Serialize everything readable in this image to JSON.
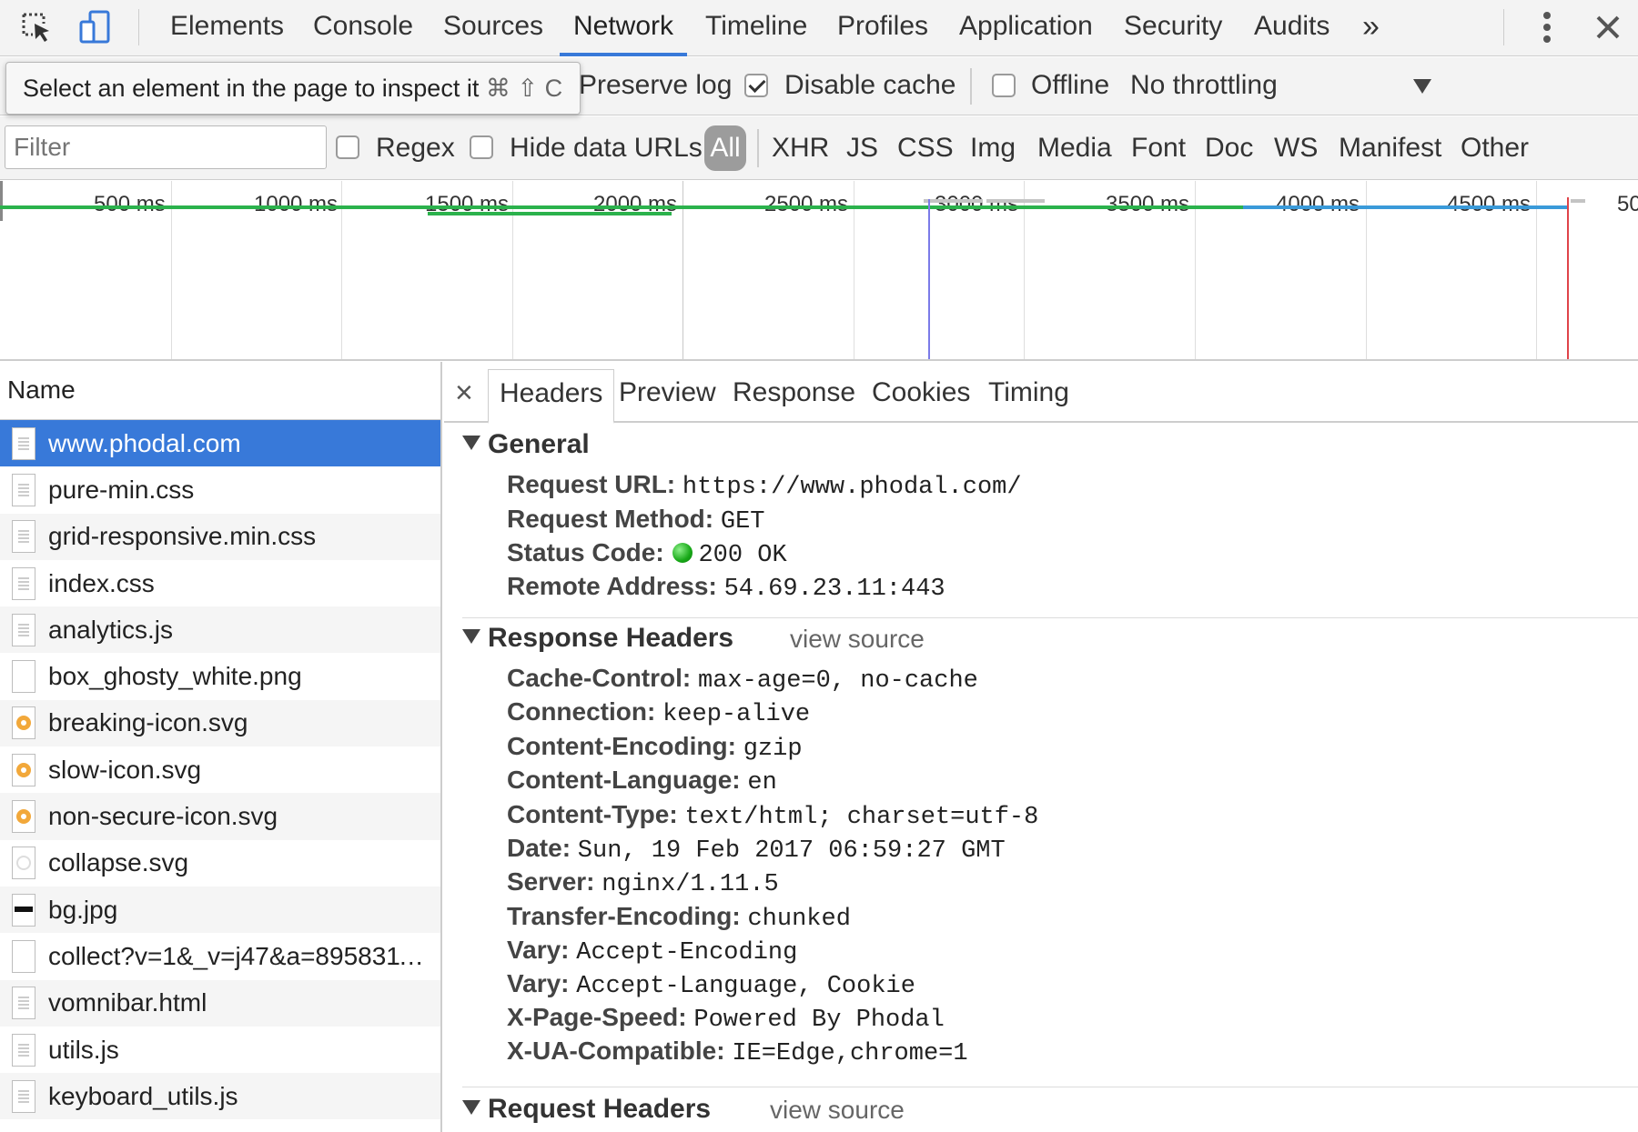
{
  "top_tabs": [
    {
      "label": "Elements"
    },
    {
      "label": "Console"
    },
    {
      "label": "Sources"
    },
    {
      "label": "Network"
    },
    {
      "label": "Timeline"
    },
    {
      "label": "Profiles"
    },
    {
      "label": "Application"
    },
    {
      "label": "Security"
    },
    {
      "label": "Audits"
    }
  ],
  "active_tab": "Network",
  "overflow_label": "»",
  "toolbar": {
    "tooltip_text": "Select an element in the page to inspect it",
    "tooltip_shortcut": "⌘ ⇧ C",
    "preserve_log": "Preserve log",
    "disable_cache": "Disable cache",
    "disable_cache_checked": true,
    "offline": "Offline",
    "offline_checked": false,
    "throttling": "No throttling"
  },
  "filter_bar": {
    "placeholder": "Filter",
    "regex": "Regex",
    "hide_data_urls": "Hide data URLs",
    "types": [
      "All",
      "XHR",
      "JS",
      "CSS",
      "Img",
      "Media",
      "Font",
      "Doc",
      "WS",
      "Manifest",
      "Other"
    ],
    "active_type": "All"
  },
  "timeline": {
    "tick_labels": [
      "500 ms",
      "1000 ms",
      "1500 ms",
      "2000 ms",
      "2500 ms",
      "3000 ms",
      "3500 ms",
      "4000 ms",
      "4500 ms",
      "50"
    ],
    "colors": {
      "green": "#2bb24c",
      "blue": "#3a9ad9",
      "purple": "#7b7be8",
      "red": "#e0444a",
      "grey": "#c4c4c4"
    }
  },
  "request_list": {
    "header": "Name",
    "rows": [
      {
        "name": "www.phodal.com",
        "icon": "document-icon",
        "selected": true
      },
      {
        "name": "pure-min.css",
        "icon": "document-icon"
      },
      {
        "name": "grid-responsive.min.css",
        "icon": "document-icon"
      },
      {
        "name": "index.css",
        "icon": "document-icon"
      },
      {
        "name": "analytics.js",
        "icon": "document-icon"
      },
      {
        "name": "box_ghosty_white.png",
        "icon": "blank-file-icon"
      },
      {
        "name": "breaking-icon.svg",
        "icon": "orange-image-icon"
      },
      {
        "name": "slow-icon.svg",
        "icon": "orange-image-icon"
      },
      {
        "name": "non-secure-icon.svg",
        "icon": "orange-image-icon"
      },
      {
        "name": "collapse.svg",
        "icon": "grey-image-icon"
      },
      {
        "name": "bg.jpg",
        "icon": "dark-image-icon"
      },
      {
        "name": "collect?v=1&_v=j47&a=89583113...",
        "icon": "blank-file-icon"
      },
      {
        "name": "vomnibar.html",
        "icon": "document-icon"
      },
      {
        "name": "utils.js",
        "icon": "document-icon"
      },
      {
        "name": "keyboard_utils.js",
        "icon": "document-icon"
      }
    ]
  },
  "details": {
    "close_label": "×",
    "tabs": [
      "Headers",
      "Preview",
      "Response",
      "Cookies",
      "Timing"
    ],
    "active_tab": "Headers",
    "general": {
      "title": "General",
      "items": [
        {
          "key": "Request URL:",
          "value": "https://www.phodal.com/"
        },
        {
          "key": "Request Method:",
          "value": "GET"
        },
        {
          "key": "Status Code:",
          "value": "200 OK"
        },
        {
          "key": "Remote Address:",
          "value": "54.69.23.11:443"
        }
      ]
    },
    "response_headers": {
      "title": "Response Headers",
      "view_source": "view source",
      "items": [
        {
          "key": "Cache-Control:",
          "value": "max-age=0, no-cache"
        },
        {
          "key": "Connection:",
          "value": "keep-alive"
        },
        {
          "key": "Content-Encoding:",
          "value": "gzip"
        },
        {
          "key": "Content-Language:",
          "value": "en"
        },
        {
          "key": "Content-Type:",
          "value": "text/html; charset=utf-8"
        },
        {
          "key": "Date:",
          "value": "Sun, 19 Feb 2017 06:59:27 GMT"
        },
        {
          "key": "Server:",
          "value": "nginx/1.11.5"
        },
        {
          "key": "Transfer-Encoding:",
          "value": "chunked"
        },
        {
          "key": "Vary:",
          "value": "Accept-Encoding"
        },
        {
          "key": "Vary:",
          "value": "Accept-Language, Cookie"
        },
        {
          "key": "X-Page-Speed:",
          "value": "Powered By Phodal"
        },
        {
          "key": "X-UA-Compatible:",
          "value": "IE=Edge,chrome=1"
        }
      ]
    },
    "request_headers": {
      "title": "Request Headers",
      "view_source": "view source"
    }
  }
}
